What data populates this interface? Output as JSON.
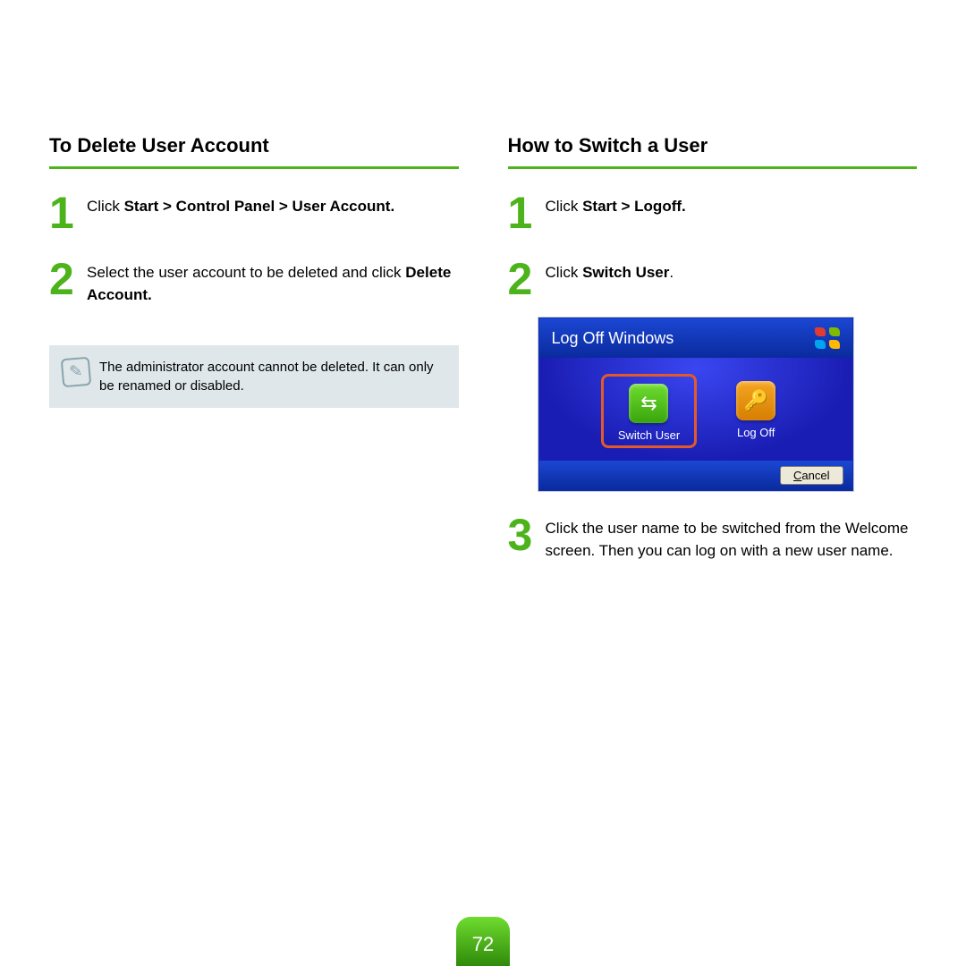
{
  "page_number": "72",
  "left": {
    "heading": "To Delete User Account",
    "step1_prefix": "Click ",
    "step1_bold": "Start > Control Panel > User Account.",
    "step2_prefix": "Select the user account to be deleted and click ",
    "step2_bold": "Delete Account.",
    "note": "The administrator account cannot be deleted. It can only be renamed or disabled."
  },
  "right": {
    "heading": "How to Switch a User",
    "step1_prefix": "Click ",
    "step1_bold": "Start > Logoff.",
    "step2_prefix": "Click ",
    "step2_bold": "Switch User",
    "step2_suffix": ".",
    "step3": "Click the user name to be switched from the Welcome screen. Then you can log on with a new user name."
  },
  "dialog": {
    "title": "Log Off Windows",
    "switch_user": "Switch User",
    "log_off": "Log Off",
    "cancel": "Cancel"
  }
}
